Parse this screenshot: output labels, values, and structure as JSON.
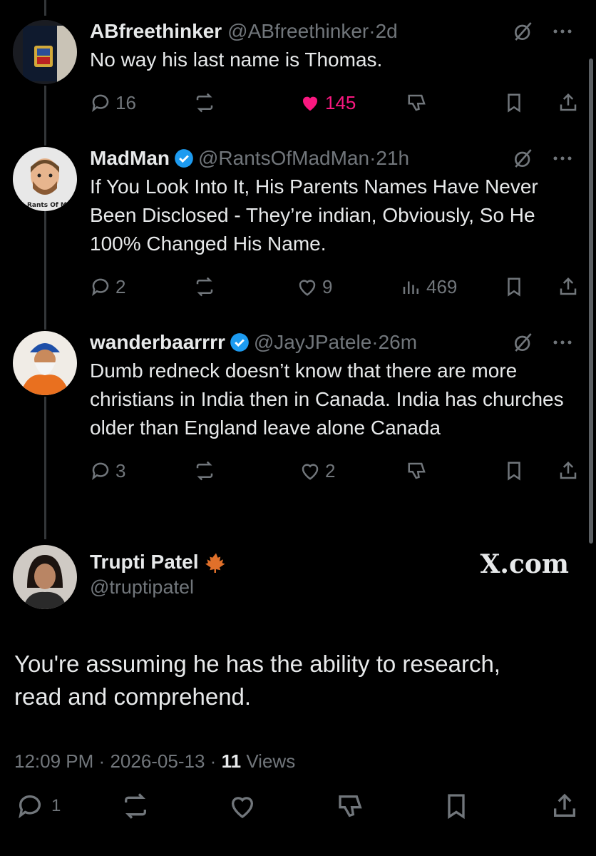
{
  "tweets": [
    {
      "name": "ABfreethinker",
      "handle": "@ABfreethinker",
      "time": "2d",
      "verified": false,
      "body": "No way his last name is Thomas.",
      "replies": "16",
      "reposts": "",
      "likes": "145",
      "liked": true,
      "views": ""
    },
    {
      "name": "MadMan",
      "handle": "@RantsOfMadMan",
      "time": "21h",
      "verified": true,
      "body": "If You Look Into It, His Parents Names Have Never Been Disclosed - They’re indian, Obviously, So He 100% Changed His Name.",
      "replies": "2",
      "reposts": "",
      "likes": "9",
      "liked": false,
      "views": "469"
    },
    {
      "name": "wanderbaarrrr",
      "handle": "@JayJPatele",
      "time": "26m",
      "verified": true,
      "body": "Dumb redneck doesn’t know that there are more christians in India then in Canada. India has churches older than England leave alone Canada",
      "replies": "3",
      "reposts": "",
      "likes": "2",
      "liked": false,
      "views": ""
    }
  ],
  "avatar_texts": {
    "madman": "Rants Of Mad M-"
  },
  "main": {
    "name": "Trupti Patel",
    "handle": "@truptipatel",
    "body_line1": "You're assuming he has the ability to research,",
    "body_line2": "read and comprehend.",
    "time": "12:09 PM",
    "date": "2026-05-13",
    "views_count": "11",
    "views_label": "Views",
    "replies": "1"
  },
  "watermark": "X.com",
  "separator": "·",
  "colors": {
    "like": "#f91880",
    "verified": "#1d9bf0",
    "muted": "#71767b",
    "leaf": "#e0702a"
  }
}
